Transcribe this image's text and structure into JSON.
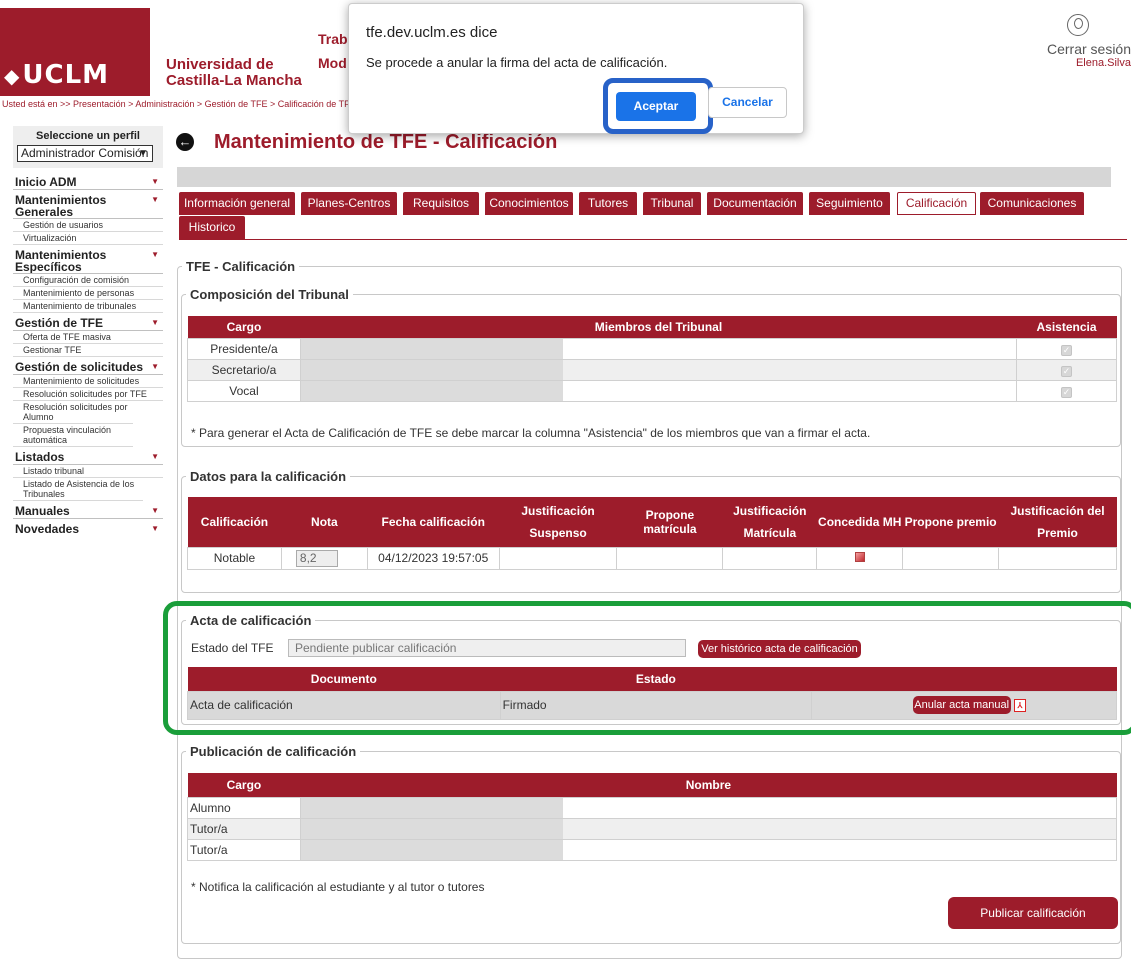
{
  "header": {
    "logo_text": "UCLM",
    "university_line1": "Universidad de",
    "university_line2": "Castilla-La Mancha",
    "title_partial_1": "Trab",
    "title_partial_2": "Mod",
    "logout": "Cerrar sesión",
    "user": "Elena.Silva",
    "breadcrumb": "Usted está en >> Presentación > Administración > Gestión de TFE > Calificación de TF"
  },
  "sidebar": {
    "profile_label": "Seleccione un perfil",
    "profile_value": "Administrador Comisión",
    "sections": [
      {
        "label": "Inicio ADM",
        "items": []
      },
      {
        "label": "Mantenimientos Generales",
        "items": [
          "Gestión de usuarios",
          "Virtualización"
        ]
      },
      {
        "label": "Mantenimientos Específicos",
        "items": [
          "Configuración de comisión",
          "Mantenimiento de personas",
          "Mantenimiento de tribunales"
        ]
      },
      {
        "label": "Gestión de TFE",
        "items": [
          "Oferta de TFE masiva",
          "Gestionar TFE"
        ]
      },
      {
        "label": "Gestión de solicitudes",
        "items": [
          "Mantenimiento de solicitudes",
          "Resolución solicitudes por TFE",
          "Resolución solicitudes por Alumno",
          "Propuesta vinculación automática"
        ]
      },
      {
        "label": "Listados",
        "items": [
          "Listado tribunal",
          "Listado de Asistencia de los Tribunales"
        ]
      },
      {
        "label": "Manuales",
        "items": []
      },
      {
        "label": "Novedades",
        "items": []
      }
    ]
  },
  "main": {
    "title": "Mantenimiento de TFE - Calificación",
    "tabs": [
      "Información general",
      "Planes-Centros",
      "Requisitos",
      "Conocimientos",
      "Tutores",
      "Tribunal",
      "Documentación",
      "Seguimiento",
      "Calificación",
      "Comunicaciones",
      "Historico"
    ],
    "active_tab": "Calificación",
    "outer_legend": "TFE - Calificación"
  },
  "tribunal": {
    "legend": "Composición del Tribunal",
    "headers": [
      "Cargo",
      "Miembros del Tribunal",
      "Asistencia"
    ],
    "rows": [
      "Presidente/a",
      "Secretario/a",
      "Vocal"
    ],
    "note": "* Para generar el Acta de Calificación de TFE se debe marcar la columna \"Asistencia\" de los miembros que van a firmar el acta."
  },
  "datos": {
    "legend": "Datos para la calificación",
    "headers": [
      "Calificación",
      "Nota",
      "Fecha calificación",
      "Justificación Suspenso",
      "Propone matrícula",
      "Justificación Matrícula",
      "Concedida MH",
      "Propone premio",
      "Justificación del Premio"
    ],
    "calificacion": "Notable",
    "nota": "8,2",
    "fecha": "04/12/2023 19:57:05"
  },
  "acta": {
    "legend": "Acta de calificación",
    "estado_label": "Estado del TFE",
    "estado_value": "Pendiente publicar calificación",
    "historico_button": "Ver histórico acta de calificación",
    "headers": [
      "Documento",
      "Estado"
    ],
    "documento": "Acta de calificación",
    "estado": "Firmado",
    "anular_button": "Anular acta manual"
  },
  "publicacion": {
    "legend": "Publicación de calificación",
    "headers": [
      "Cargo",
      "Nombre"
    ],
    "rows": [
      "Alumno",
      "Tutor/a",
      "Tutor/a"
    ],
    "note": "* Notifica la calificación al estudiante y al tutor o tutores",
    "button": "Publicar calificación"
  },
  "dialog": {
    "origin": "tfe.dev.uclm.es dice",
    "message": "Se procede a anular la firma del acta de calificación.",
    "ok": "Aceptar",
    "cancel": "Cancelar"
  },
  "colors": {
    "brand": "#9d1c2b",
    "highlight_green": "#1a9e3a",
    "highlight_blue": "#2862c8",
    "dialog_button": "#1a73e8"
  }
}
